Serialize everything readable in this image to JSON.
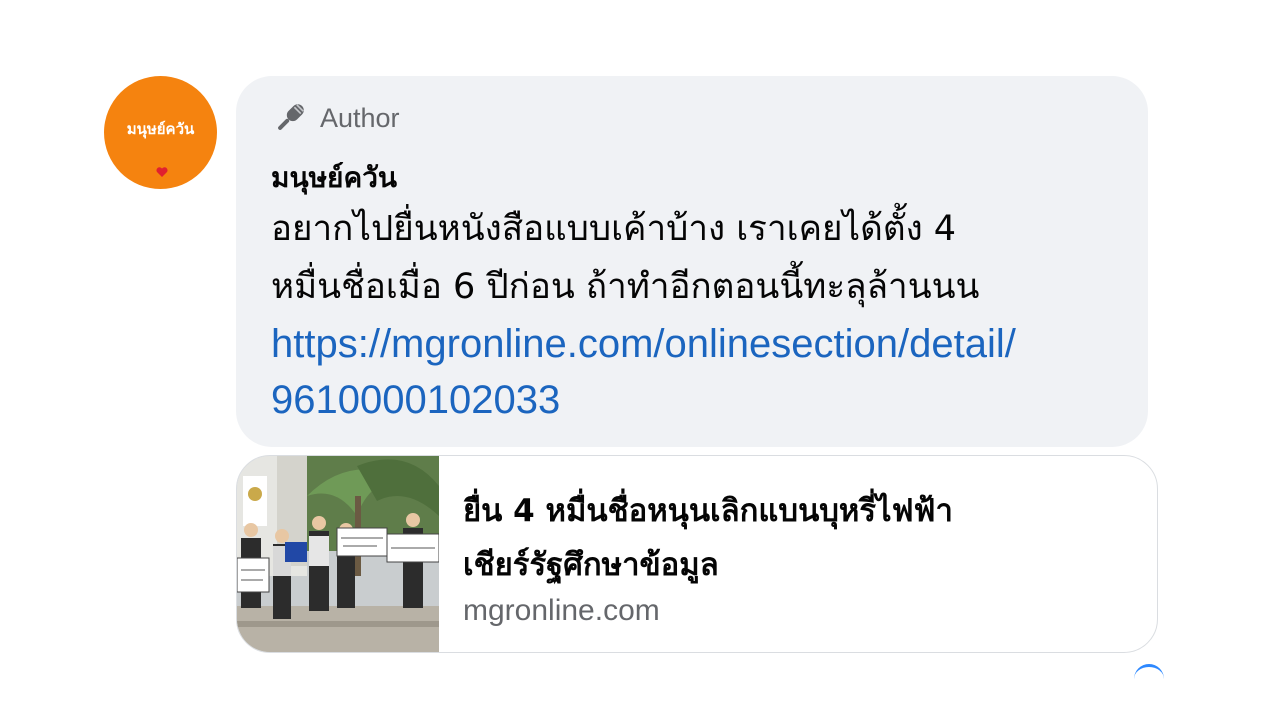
{
  "comment": {
    "avatar_text": "มนุษย์ควัน",
    "badge_icon": "microphone-icon",
    "badge_label": "Author",
    "author_name": "มนุษย์ควัน",
    "message_lines": [
      "อยากไปยื่นหนังสือแบบเค้าบ้าง เราเคยได้ตั้ง 4",
      "หมื่นชื่อเมื่อ 6 ปีก่อน ถ้าทำอีกตอนนี้ทะลุล้านนน"
    ],
    "link_lines": [
      "https://mgronline.com/onlinesection/detail/",
      "9610000102033"
    ]
  },
  "preview": {
    "title_lines": [
      "ยื่น 4 หมื่นชื่อหนุนเลิกแบนบุหรี่ไฟฟ้า",
      "เชียร์รัฐศึกษาข้อมูล"
    ],
    "domain": "mgronline.com"
  },
  "colors": {
    "avatar_bg": "#f5830f",
    "bubble_bg": "#f0f2f5",
    "link": "#1b65bf",
    "muted": "#65676b"
  }
}
